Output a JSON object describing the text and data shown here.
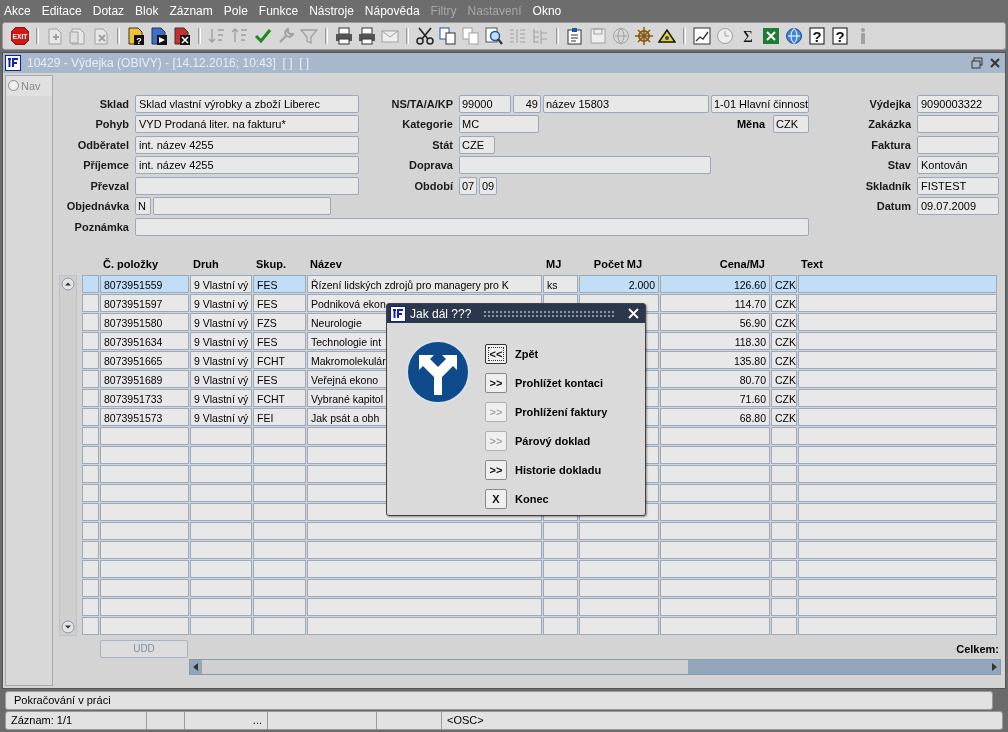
{
  "menu": [
    {
      "label": "Akce",
      "disabled": false
    },
    {
      "label": "Editace",
      "disabled": false
    },
    {
      "label": "Dotaz",
      "disabled": false
    },
    {
      "label": "Blok",
      "disabled": false
    },
    {
      "label": "Záznam",
      "disabled": false
    },
    {
      "label": "Pole",
      "disabled": false
    },
    {
      "label": "Funkce",
      "disabled": false
    },
    {
      "label": "Nástroje",
      "disabled": false
    },
    {
      "label": "Nápověda",
      "disabled": false
    },
    {
      "label": "Filtry",
      "disabled": true
    },
    {
      "label": "Nastavení",
      "disabled": true
    },
    {
      "label": "Okno",
      "disabled": false
    }
  ],
  "toolbar": [
    {
      "kind": "exit",
      "glyph": "EXIT",
      "disabled": false
    },
    {
      "kind": "separator"
    },
    {
      "kind": "doc-plus",
      "disabled": true
    },
    {
      "kind": "docs",
      "disabled": true
    },
    {
      "kind": "doc-x",
      "disabled": true
    },
    {
      "kind": "separator"
    },
    {
      "kind": "doc-query",
      "glyph": "?",
      "disabled": false
    },
    {
      "kind": "doc-play",
      "disabled": false
    },
    {
      "kind": "doc-cancel",
      "disabled": false
    },
    {
      "kind": "separator"
    },
    {
      "kind": "sort-asc",
      "disabled": true
    },
    {
      "kind": "sort-desc",
      "disabled": true
    },
    {
      "kind": "check",
      "disabled": false
    },
    {
      "kind": "wrench",
      "disabled": true
    },
    {
      "kind": "funnel",
      "disabled": true
    },
    {
      "kind": "separator"
    },
    {
      "kind": "printer",
      "disabled": false
    },
    {
      "kind": "printer",
      "disabled": false
    },
    {
      "kind": "envelope",
      "disabled": true
    },
    {
      "kind": "separator"
    },
    {
      "kind": "scissors",
      "disabled": false
    },
    {
      "kind": "copy",
      "disabled": false
    },
    {
      "kind": "paste",
      "disabled": true
    },
    {
      "kind": "magnifier",
      "disabled": false
    },
    {
      "kind": "list",
      "disabled": true
    },
    {
      "kind": "tree",
      "disabled": true
    },
    {
      "kind": "separator"
    },
    {
      "kind": "clipboard",
      "disabled": false
    },
    {
      "kind": "floppy",
      "disabled": true
    },
    {
      "kind": "globe",
      "disabled": true
    },
    {
      "kind": "wheel",
      "disabled": false
    },
    {
      "kind": "triangle",
      "disabled": false
    },
    {
      "kind": "separator"
    },
    {
      "kind": "chart",
      "disabled": false
    },
    {
      "kind": "clock",
      "disabled": true
    },
    {
      "kind": "sigma",
      "glyph": "Σ",
      "disabled": false
    },
    {
      "kind": "sheet",
      "disabled": false
    },
    {
      "kind": "globe",
      "disabled": false
    },
    {
      "kind": "help",
      "glyph": "?",
      "disabled": false
    },
    {
      "kind": "help",
      "glyph": "?",
      "disabled": false
    },
    {
      "kind": "info",
      "disabled": true
    }
  ],
  "window": {
    "title": "10429 - Výdejka (OBIVY) - [14.12.2016; 10:43]  [ ]  [ ]"
  },
  "nav": {
    "label": "Nav",
    "selected": false
  },
  "form": {
    "sklad": {
      "label": "Sklad",
      "value": "Sklad vlastní výrobky a zboží Liberec"
    },
    "pohyb": {
      "label": "Pohyb",
      "value": "VYD Prodaná liter. na fakturu*"
    },
    "odberatel": {
      "label": "Odběratel",
      "value": "int. název 4255"
    },
    "prijemce": {
      "label": "Příjemce",
      "value": "int. název 4255"
    },
    "prevzal": {
      "label": "Převzal"
    },
    "objednavka": {
      "label": "Objednávka",
      "value": "N"
    },
    "poznamka": {
      "label": "Poznámka"
    },
    "ns": {
      "label": "NS/TA/A/KP",
      "values": [
        "99000",
        "49",
        "název 15803",
        "1-01 Hlavní činnost"
      ]
    },
    "kategorie": {
      "label": "Kategorie",
      "value": "MC"
    },
    "mena": {
      "label": "Měna",
      "value": "CZK"
    },
    "stat": {
      "label": "Stát",
      "value": "CZE"
    },
    "doprava": {
      "label": "Doprava"
    },
    "obdobi": {
      "label": "Období",
      "values": [
        "07",
        "09"
      ]
    },
    "vydejka": {
      "label": "Výdejka",
      "value": "9090003322"
    },
    "zakazka": {
      "label": "Zakázka"
    },
    "faktura": {
      "label": "Faktura"
    },
    "stav": {
      "label": "Stav",
      "value": "Kontován"
    },
    "skladnik": {
      "label": "Skladník",
      "value": "FISTEST"
    },
    "datum": {
      "label": "Datum",
      "value": "09.07.2009"
    }
  },
  "table": {
    "columns": [
      "Č. položky",
      "Druh",
      "Skup.",
      "Název",
      "MJ",
      "Počet MJ",
      "Cena/MJ",
      "Text"
    ],
    "rows": [
      {
        "selected": true,
        "polozka": "8073951559",
        "druh": "9 Vlastní vý",
        "skup": "FES",
        "nazev": "Řízení lidských zdrojů pro managery pro K",
        "mj": "ks",
        "pocet": "2.000",
        "cena": "126.60",
        "mena": "CZK"
      },
      {
        "selected": false,
        "polozka": "8073951597",
        "druh": "9 Vlastní vý",
        "skup": "FES",
        "nazev": "Podniková ekon",
        "cena": "114.70",
        "mena": "CZK"
      },
      {
        "selected": false,
        "polozka": "8073951580",
        "druh": "9 Vlastní vý",
        "skup": "FZS",
        "nazev": "Neurologie",
        "cena": "56.90",
        "mena": "CZK"
      },
      {
        "selected": false,
        "polozka": "8073951634",
        "druh": "9 Vlastní vý",
        "skup": "FES",
        "nazev": "Technologie int",
        "cena": "118.30",
        "mena": "CZK"
      },
      {
        "selected": false,
        "polozka": "8073951665",
        "druh": "9 Vlastní vý",
        "skup": "FCHT",
        "nazev": "Makromolekulár",
        "cena": "135.80",
        "mena": "CZK"
      },
      {
        "selected": false,
        "polozka": "8073951689",
        "druh": "9 Vlastní vý",
        "skup": "FES",
        "nazev": "Veřejná ekono",
        "cena": "80.70",
        "mena": "CZK"
      },
      {
        "selected": false,
        "polozka": "8073951733",
        "druh": "9 Vlastní vý",
        "skup": "FCHT",
        "nazev": "Vybrané kapitol",
        "cena": "71.60",
        "mena": "CZK"
      },
      {
        "selected": false,
        "polozka": "8073951573",
        "druh": "9 Vlastní vý",
        "skup": "FEI",
        "nazev": "Jak psát a obh",
        "cena": "68.80",
        "mena": "CZK"
      }
    ]
  },
  "udd_button": {
    "label": "UDD",
    "disabled": true
  },
  "total_label": "Celkem:",
  "dialog": {
    "title": "Jak dál ???",
    "buttons": [
      {
        "symbol": "<<",
        "label": "Zpět",
        "disabled": false,
        "focused": true
      },
      {
        "symbol": ">>",
        "label": "Prohlížet kontaci",
        "disabled": false,
        "focused": false
      },
      {
        "symbol": ">>",
        "label": "Prohlížení faktury",
        "disabled": true,
        "focused": false
      },
      {
        "symbol": ">>",
        "label": "Párový doklad",
        "disabled": true,
        "focused": false
      },
      {
        "symbol": ">>",
        "label": "Historie dokladu",
        "disabled": false,
        "focused": false
      },
      {
        "symbol": "X",
        "label": "Konec",
        "disabled": false,
        "focused": false
      }
    ]
  },
  "status_bar": {
    "message": "Pokračování v práci",
    "record": "Záznam: 1/1",
    "segment_3": "...",
    "mode": "<OSC>"
  }
}
